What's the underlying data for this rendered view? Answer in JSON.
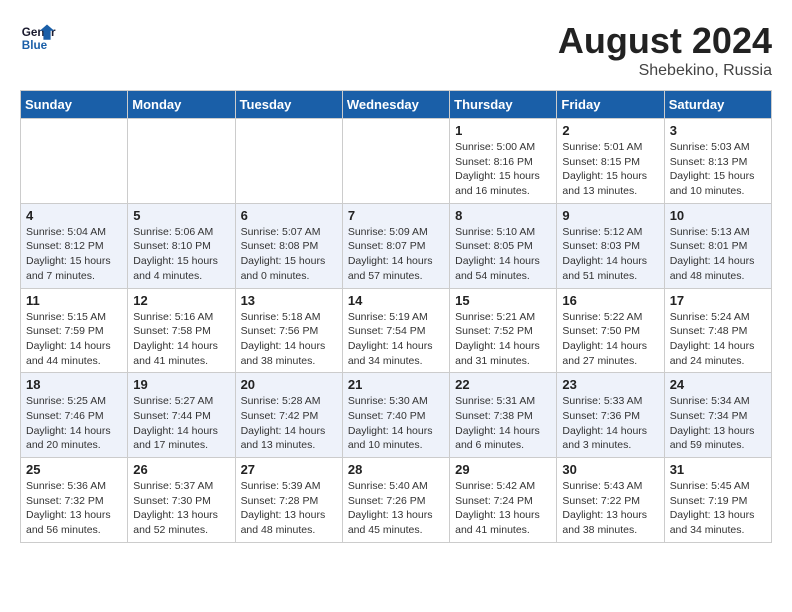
{
  "header": {
    "logo_line1": "General",
    "logo_line2": "Blue",
    "month_year": "August 2024",
    "location": "Shebekino, Russia"
  },
  "days_of_week": [
    "Sunday",
    "Monday",
    "Tuesday",
    "Wednesday",
    "Thursday",
    "Friday",
    "Saturday"
  ],
  "weeks": [
    [
      {
        "day": "",
        "detail": ""
      },
      {
        "day": "",
        "detail": ""
      },
      {
        "day": "",
        "detail": ""
      },
      {
        "day": "",
        "detail": ""
      },
      {
        "day": "1",
        "detail": "Sunrise: 5:00 AM\nSunset: 8:16 PM\nDaylight: 15 hours\nand 16 minutes."
      },
      {
        "day": "2",
        "detail": "Sunrise: 5:01 AM\nSunset: 8:15 PM\nDaylight: 15 hours\nand 13 minutes."
      },
      {
        "day": "3",
        "detail": "Sunrise: 5:03 AM\nSunset: 8:13 PM\nDaylight: 15 hours\nand 10 minutes."
      }
    ],
    [
      {
        "day": "4",
        "detail": "Sunrise: 5:04 AM\nSunset: 8:12 PM\nDaylight: 15 hours\nand 7 minutes."
      },
      {
        "day": "5",
        "detail": "Sunrise: 5:06 AM\nSunset: 8:10 PM\nDaylight: 15 hours\nand 4 minutes."
      },
      {
        "day": "6",
        "detail": "Sunrise: 5:07 AM\nSunset: 8:08 PM\nDaylight: 15 hours\nand 0 minutes."
      },
      {
        "day": "7",
        "detail": "Sunrise: 5:09 AM\nSunset: 8:07 PM\nDaylight: 14 hours\nand 57 minutes."
      },
      {
        "day": "8",
        "detail": "Sunrise: 5:10 AM\nSunset: 8:05 PM\nDaylight: 14 hours\nand 54 minutes."
      },
      {
        "day": "9",
        "detail": "Sunrise: 5:12 AM\nSunset: 8:03 PM\nDaylight: 14 hours\nand 51 minutes."
      },
      {
        "day": "10",
        "detail": "Sunrise: 5:13 AM\nSunset: 8:01 PM\nDaylight: 14 hours\nand 48 minutes."
      }
    ],
    [
      {
        "day": "11",
        "detail": "Sunrise: 5:15 AM\nSunset: 7:59 PM\nDaylight: 14 hours\nand 44 minutes."
      },
      {
        "day": "12",
        "detail": "Sunrise: 5:16 AM\nSunset: 7:58 PM\nDaylight: 14 hours\nand 41 minutes."
      },
      {
        "day": "13",
        "detail": "Sunrise: 5:18 AM\nSunset: 7:56 PM\nDaylight: 14 hours\nand 38 minutes."
      },
      {
        "day": "14",
        "detail": "Sunrise: 5:19 AM\nSunset: 7:54 PM\nDaylight: 14 hours\nand 34 minutes."
      },
      {
        "day": "15",
        "detail": "Sunrise: 5:21 AM\nSunset: 7:52 PM\nDaylight: 14 hours\nand 31 minutes."
      },
      {
        "day": "16",
        "detail": "Sunrise: 5:22 AM\nSunset: 7:50 PM\nDaylight: 14 hours\nand 27 minutes."
      },
      {
        "day": "17",
        "detail": "Sunrise: 5:24 AM\nSunset: 7:48 PM\nDaylight: 14 hours\nand 24 minutes."
      }
    ],
    [
      {
        "day": "18",
        "detail": "Sunrise: 5:25 AM\nSunset: 7:46 PM\nDaylight: 14 hours\nand 20 minutes."
      },
      {
        "day": "19",
        "detail": "Sunrise: 5:27 AM\nSunset: 7:44 PM\nDaylight: 14 hours\nand 17 minutes."
      },
      {
        "day": "20",
        "detail": "Sunrise: 5:28 AM\nSunset: 7:42 PM\nDaylight: 14 hours\nand 13 minutes."
      },
      {
        "day": "21",
        "detail": "Sunrise: 5:30 AM\nSunset: 7:40 PM\nDaylight: 14 hours\nand 10 minutes."
      },
      {
        "day": "22",
        "detail": "Sunrise: 5:31 AM\nSunset: 7:38 PM\nDaylight: 14 hours\nand 6 minutes."
      },
      {
        "day": "23",
        "detail": "Sunrise: 5:33 AM\nSunset: 7:36 PM\nDaylight: 14 hours\nand 3 minutes."
      },
      {
        "day": "24",
        "detail": "Sunrise: 5:34 AM\nSunset: 7:34 PM\nDaylight: 13 hours\nand 59 minutes."
      }
    ],
    [
      {
        "day": "25",
        "detail": "Sunrise: 5:36 AM\nSunset: 7:32 PM\nDaylight: 13 hours\nand 56 minutes."
      },
      {
        "day": "26",
        "detail": "Sunrise: 5:37 AM\nSunset: 7:30 PM\nDaylight: 13 hours\nand 52 minutes."
      },
      {
        "day": "27",
        "detail": "Sunrise: 5:39 AM\nSunset: 7:28 PM\nDaylight: 13 hours\nand 48 minutes."
      },
      {
        "day": "28",
        "detail": "Sunrise: 5:40 AM\nSunset: 7:26 PM\nDaylight: 13 hours\nand 45 minutes."
      },
      {
        "day": "29",
        "detail": "Sunrise: 5:42 AM\nSunset: 7:24 PM\nDaylight: 13 hours\nand 41 minutes."
      },
      {
        "day": "30",
        "detail": "Sunrise: 5:43 AM\nSunset: 7:22 PM\nDaylight: 13 hours\nand 38 minutes."
      },
      {
        "day": "31",
        "detail": "Sunrise: 5:45 AM\nSunset: 7:19 PM\nDaylight: 13 hours\nand 34 minutes."
      }
    ]
  ]
}
